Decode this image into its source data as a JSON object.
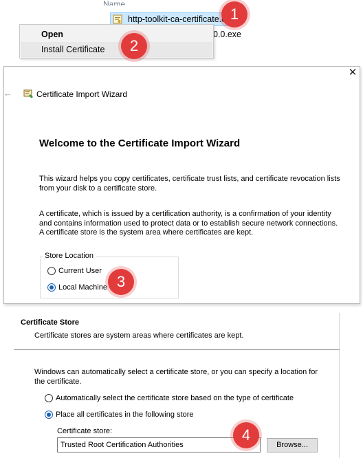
{
  "explorer": {
    "column_header": "Name",
    "files": [
      {
        "name": "http-toolkit-ca-certificate.crt"
      },
      {
        "name": "0.0.exe"
      }
    ]
  },
  "context_menu": {
    "items": [
      "Open",
      "Install Certificate"
    ]
  },
  "badges": [
    "1",
    "2",
    "3",
    "4"
  ],
  "wizard": {
    "title": "Certificate Import Wizard",
    "heading": "Welcome to the Certificate Import Wizard",
    "para1": "This wizard helps you copy certificates, certificate trust lists, and certificate revocation lists from your disk to a certificate store.",
    "para2": "A certificate, which is issued by a certification authority, is a confirmation of your identity and contains information used to protect data or to establish secure network connections. A certificate store is the system area where certificates are kept.",
    "store_location": {
      "legend": "Store Location",
      "options": [
        {
          "label": "Current User",
          "selected": false
        },
        {
          "label": "Local Machine",
          "selected": true
        }
      ]
    },
    "close_glyph": "✕",
    "back_glyph": "←"
  },
  "cert_store_page": {
    "title": "Certificate Store",
    "subtitle": "Certificate stores are system areas where certificates are kept.",
    "para": "Windows can automatically select a certificate store, or you can specify a location for the certificate.",
    "options": [
      {
        "label": "Automatically select the certificate store based on the type of certificate",
        "selected": false
      },
      {
        "label": "Place all certificates in the following store",
        "selected": true
      }
    ],
    "store_label": "Certificate store:",
    "store_value": "Trusted Root Certification Authorities",
    "browse_label": "Browse..."
  },
  "colors": {
    "badge": "#e23b3b",
    "selection": "#cce8ff",
    "radio_selected": "#1a5fb4"
  },
  "icons": [
    "certificate-file-icon",
    "certificate-wizard-icon",
    "back-arrow-icon",
    "close-icon"
  ]
}
